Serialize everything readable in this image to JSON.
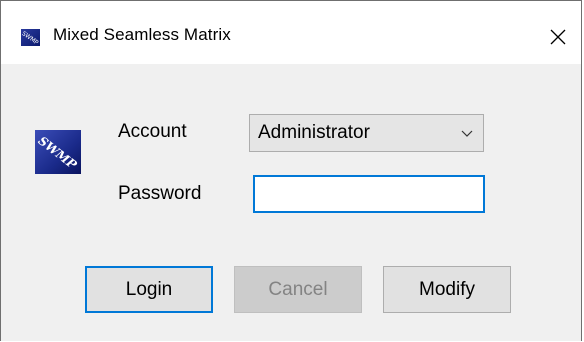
{
  "window": {
    "title": "Mixed Seamless Matrix",
    "close_glyph": "✕"
  },
  "logo": {
    "text": "SWMP",
    "icon": "swmp-logo-icon"
  },
  "form": {
    "account_label": "Account",
    "account_value": "Administrator",
    "password_label": "Password",
    "password_value": "",
    "password_placeholder": ""
  },
  "buttons": {
    "login": "Login",
    "cancel": "Cancel",
    "modify": "Modify"
  },
  "colors": {
    "accent": "#0078d7",
    "disabled_text": "#838383"
  }
}
